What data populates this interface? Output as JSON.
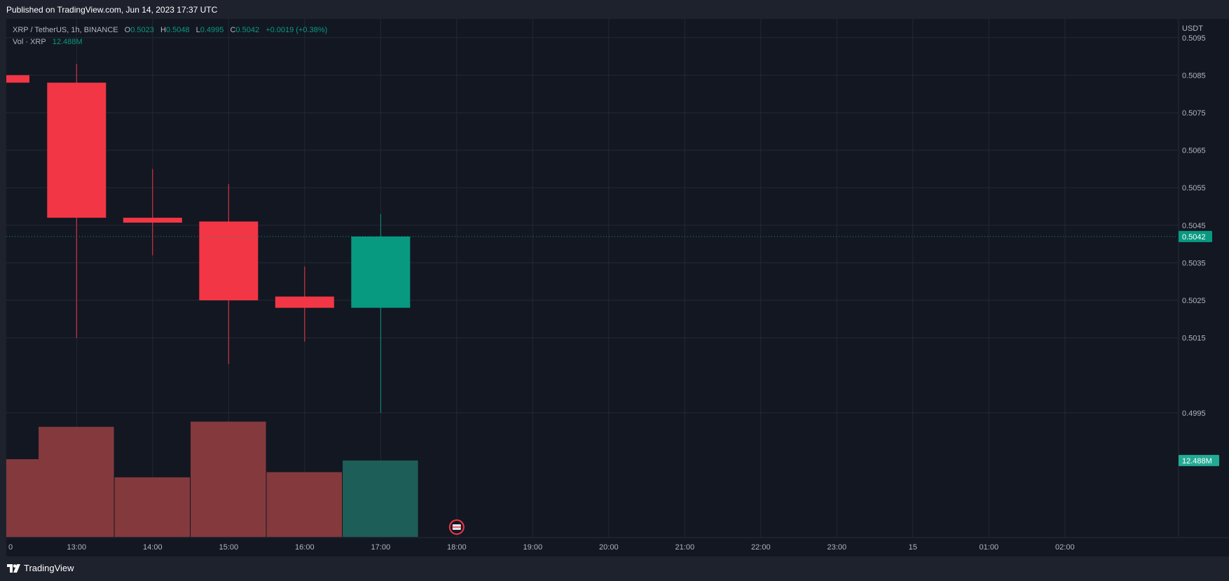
{
  "header": {
    "published": "Published on TradingView.com, Jun 14, 2023 17:37 UTC"
  },
  "legend": {
    "symbol": "XRP / TetherUS, 1h, BINANCE",
    "o_label": "O",
    "o_value": "0.5023",
    "h_label": "H",
    "h_value": "0.5048",
    "l_label": "L",
    "l_value": "0.4995",
    "c_label": "C",
    "c_value": "0.5042",
    "change": "+0.0019 (+0.38%)",
    "vol_label": "Vol · XRP",
    "vol_value": "12.488M"
  },
  "footer": {
    "brand": "TradingView"
  },
  "colors": {
    "background": "#131722",
    "frame": "#1e222d",
    "grid": "#232834",
    "up": "#089981",
    "down": "#f23645",
    "vol_up": "#1e5e58",
    "vol_down": "#843a3d",
    "axis_text": "#b2b5be"
  },
  "chart_data": {
    "type": "candlestick",
    "interval": "1h",
    "currency_label": "USDT",
    "candles": [
      {
        "time": "12:00",
        "open": 0.5085,
        "high": 0.5085,
        "low": 0.5083,
        "close": 0.5083,
        "volume": 0.6
      },
      {
        "time": "13:00",
        "open": 0.5083,
        "high": 0.5088,
        "low": 0.5015,
        "close": 0.5047,
        "volume": 0.85
      },
      {
        "time": "14:00",
        "open": 0.5047,
        "high": 0.506,
        "low": 0.5037,
        "close": 0.5046,
        "volume": 0.46
      },
      {
        "time": "15:00",
        "open": 0.5046,
        "high": 0.5056,
        "low": 0.5008,
        "close": 0.5025,
        "volume": 0.89
      },
      {
        "time": "16:00",
        "open": 0.5026,
        "high": 0.5034,
        "low": 0.5014,
        "close": 0.5023,
        "volume": 0.5
      },
      {
        "time": "17:00",
        "open": 0.5023,
        "high": 0.5048,
        "low": 0.4995,
        "close": 0.5042,
        "volume": 0.59
      }
    ],
    "volume_scale_note": "",
    "y_ticks": [
      "0.5095",
      "0.5085",
      "0.5075",
      "0.5065",
      "0.5055",
      "0.5045",
      "0.5035",
      "0.5025",
      "0.5015",
      "0.4995"
    ],
    "x_ticks": [
      "0",
      "13:00",
      "14:00",
      "15:00",
      "16:00",
      "17:00",
      "18:00",
      "19:00",
      "20:00",
      "21:00",
      "22:00",
      "23:00",
      "15",
      "01:00",
      "02:00"
    ],
    "last_price_label": "0.5042",
    "last_volume_label": "12.488M",
    "grid": true
  }
}
